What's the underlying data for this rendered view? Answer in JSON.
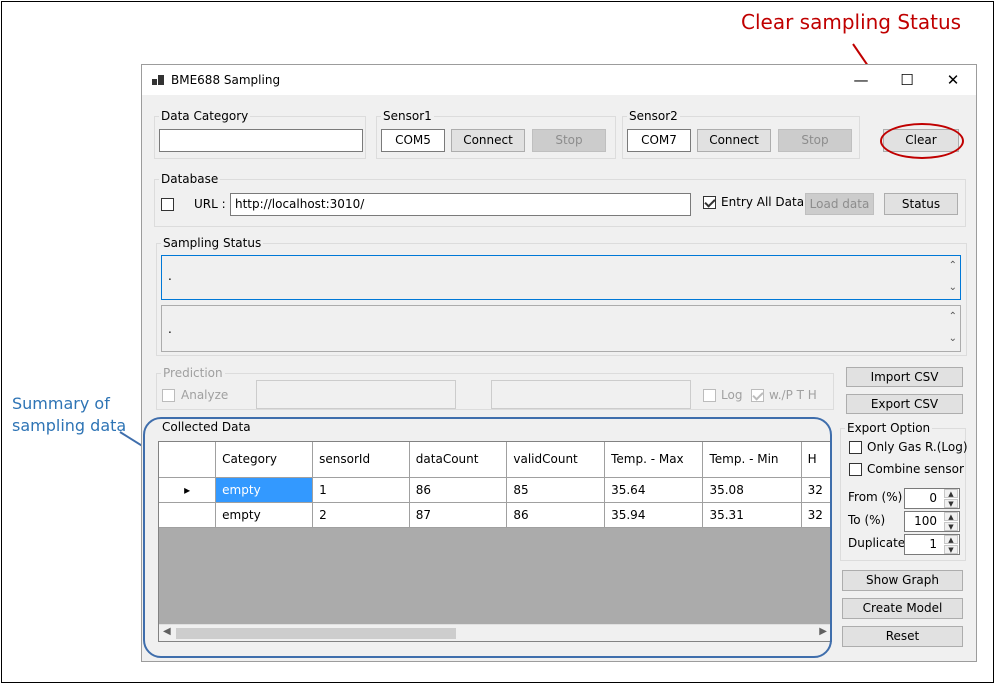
{
  "window": {
    "title": "BME688 Sampling",
    "controls": {
      "minimize": "—",
      "maximize": "☐",
      "close": "✕"
    }
  },
  "data_category": {
    "legend": "Data Category",
    "value": ""
  },
  "sensor1": {
    "legend": "Sensor1",
    "port": "COM5",
    "connect_label": "Connect",
    "stop_label": "Stop"
  },
  "sensor2": {
    "legend": "Sensor2",
    "port": "COM7",
    "connect_label": "Connect",
    "stop_label": "Stop"
  },
  "clear_label": "Clear",
  "database": {
    "legend": "Database",
    "url_label": "URL :",
    "url_value": "http://localhost:3010/",
    "entry_all_label": "Entry All Data",
    "load_label": "Load data",
    "status_label": "Status"
  },
  "sampling_status": {
    "legend": "Sampling Status",
    "line1": ".",
    "line2": "."
  },
  "prediction": {
    "legend": "Prediction",
    "analyze_label": "Analyze",
    "log_label": "Log",
    "wpth_label": "w./P T H"
  },
  "import_label": "Import CSV",
  "export_label": "Export CSV",
  "collected": {
    "legend": "Collected Data",
    "columns": [
      "Category",
      "sensorId",
      "dataCount",
      "validCount",
      "Temp. - Max",
      "Temp. - Min",
      "H"
    ],
    "rows": [
      {
        "marker": "▸",
        "cells": [
          "empty",
          "1",
          "86",
          "85",
          "35.64",
          "35.08",
          "32"
        ]
      },
      {
        "marker": "",
        "cells": [
          "empty",
          "2",
          "87",
          "86",
          "35.94",
          "35.31",
          "32"
        ]
      }
    ]
  },
  "export_option": {
    "legend": "Export Option",
    "only_gas_label": "Only Gas R.(Log)",
    "combine_label": "Combine sensor",
    "from_label": "From (%)",
    "from_value": "0",
    "to_label": "To (%)",
    "to_value": "100",
    "duplicate_label": "Duplicate",
    "duplicate_value": "1"
  },
  "show_graph_label": "Show Graph",
  "create_model_label": "Create Model",
  "reset_label": "Reset",
  "annotations": {
    "clear_status": "Clear sampling Status",
    "summary_line1": "Summary of",
    "summary_line2": "sampling data"
  },
  "colors": {
    "annotation_red": "#c00000",
    "annotation_blue": "#2e74b5",
    "selection": "#3399ff"
  }
}
